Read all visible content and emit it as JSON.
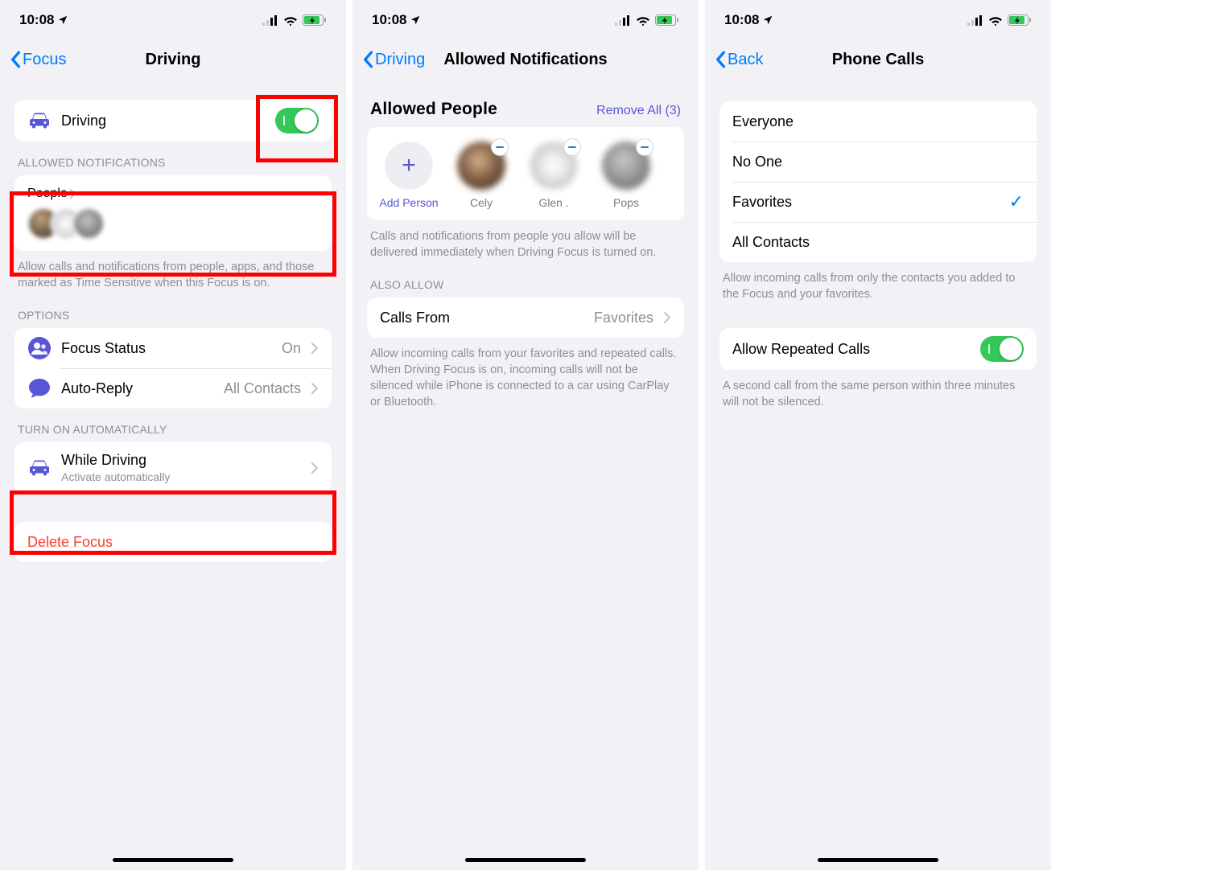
{
  "status": {
    "time": "10:08"
  },
  "screen1": {
    "back": "Focus",
    "title": "Driving",
    "driving_row": "Driving",
    "section_allowed": "ALLOWED NOTIFICATIONS",
    "people_label": "People",
    "allowed_footer": "Allow calls and notifications from people, apps, and those marked as Time Sensitive when this Focus is on.",
    "section_options": "OPTIONS",
    "focus_status_label": "Focus Status",
    "focus_status_value": "On",
    "autoreply_label": "Auto-Reply",
    "autoreply_value": "All Contacts",
    "section_auto": "TURN ON AUTOMATICALLY",
    "while_driving_label": "While Driving",
    "while_driving_sub": "Activate automatically",
    "delete_label": "Delete Focus"
  },
  "screen2": {
    "back": "Driving",
    "title": "Allowed Notifications",
    "header": "Allowed People",
    "remove_all": "Remove All (3)",
    "add_person": "Add Person",
    "people": [
      {
        "name": "Cely"
      },
      {
        "name": "Glen ."
      },
      {
        "name": "Pops"
      }
    ],
    "footer1": "Calls and notifications from people you allow will be delivered immediately when Driving Focus is turned on.",
    "section_also": "ALSO ALLOW",
    "calls_from_label": "Calls From",
    "calls_from_value": "Favorites",
    "footer2": "Allow incoming calls from your favorites and repeated calls. When Driving Focus is on, incoming calls will not be silenced while iPhone is connected to a car using CarPlay or Bluetooth."
  },
  "screen3": {
    "back": "Back",
    "title": "Phone Calls",
    "options": [
      "Everyone",
      "No One",
      "Favorites",
      "All Contacts"
    ],
    "selected_index": 2,
    "footer1": "Allow incoming calls from only the contacts you added to the Focus and your favorites.",
    "repeated_label": "Allow Repeated Calls",
    "footer2": "A second call from the same person within three minutes will not be silenced."
  }
}
